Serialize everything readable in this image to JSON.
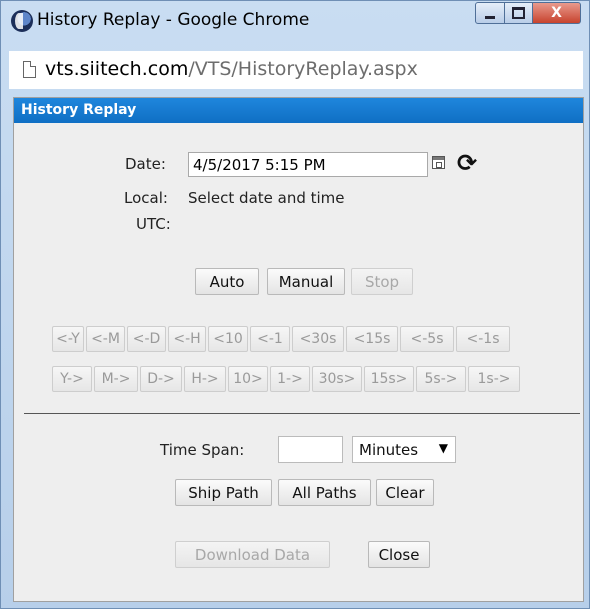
{
  "window": {
    "title": "History Replay - Google Chrome",
    "controls": {
      "minimize_icon": "minimize-icon",
      "maximize_icon": "maximize-icon",
      "close_label": "X"
    }
  },
  "address_bar": {
    "host": "vts.siitech.com",
    "path": "/VTS/HistoryReplay.aspx"
  },
  "dialog": {
    "title": "History Replay",
    "date_label": "Date:",
    "date_value": "4/5/2017 5:15 PM",
    "local_label": "Local:",
    "local_value": "Select date and time",
    "utc_label": "UTC:",
    "refresh_glyph": "⟳",
    "playback": {
      "auto": "Auto",
      "manual": "Manual",
      "stop": "Stop"
    },
    "back_buttons": [
      "<-Y",
      "<-M",
      "<-D",
      "<-H",
      "<10",
      "<-1",
      "<30s",
      "<15s",
      "<-5s",
      "<-1s"
    ],
    "forward_buttons": [
      "Y->",
      "M->",
      "D->",
      "H->",
      "10>",
      "1->",
      "30s>",
      "15s>",
      "5s->",
      "1s->"
    ],
    "time_span_label": "Time Span:",
    "time_span_value": "",
    "unit_selected": "Minutes",
    "select_arrow": "▼",
    "ship_path": "Ship Path",
    "all_paths": "All Paths",
    "clear": "Clear",
    "download_data": "Download Data",
    "close": "Close"
  },
  "colors": {
    "header_blue": "#1a7fd6",
    "dialog_bg": "#eeeeee",
    "disabled_text": "#a8a8a8"
  }
}
